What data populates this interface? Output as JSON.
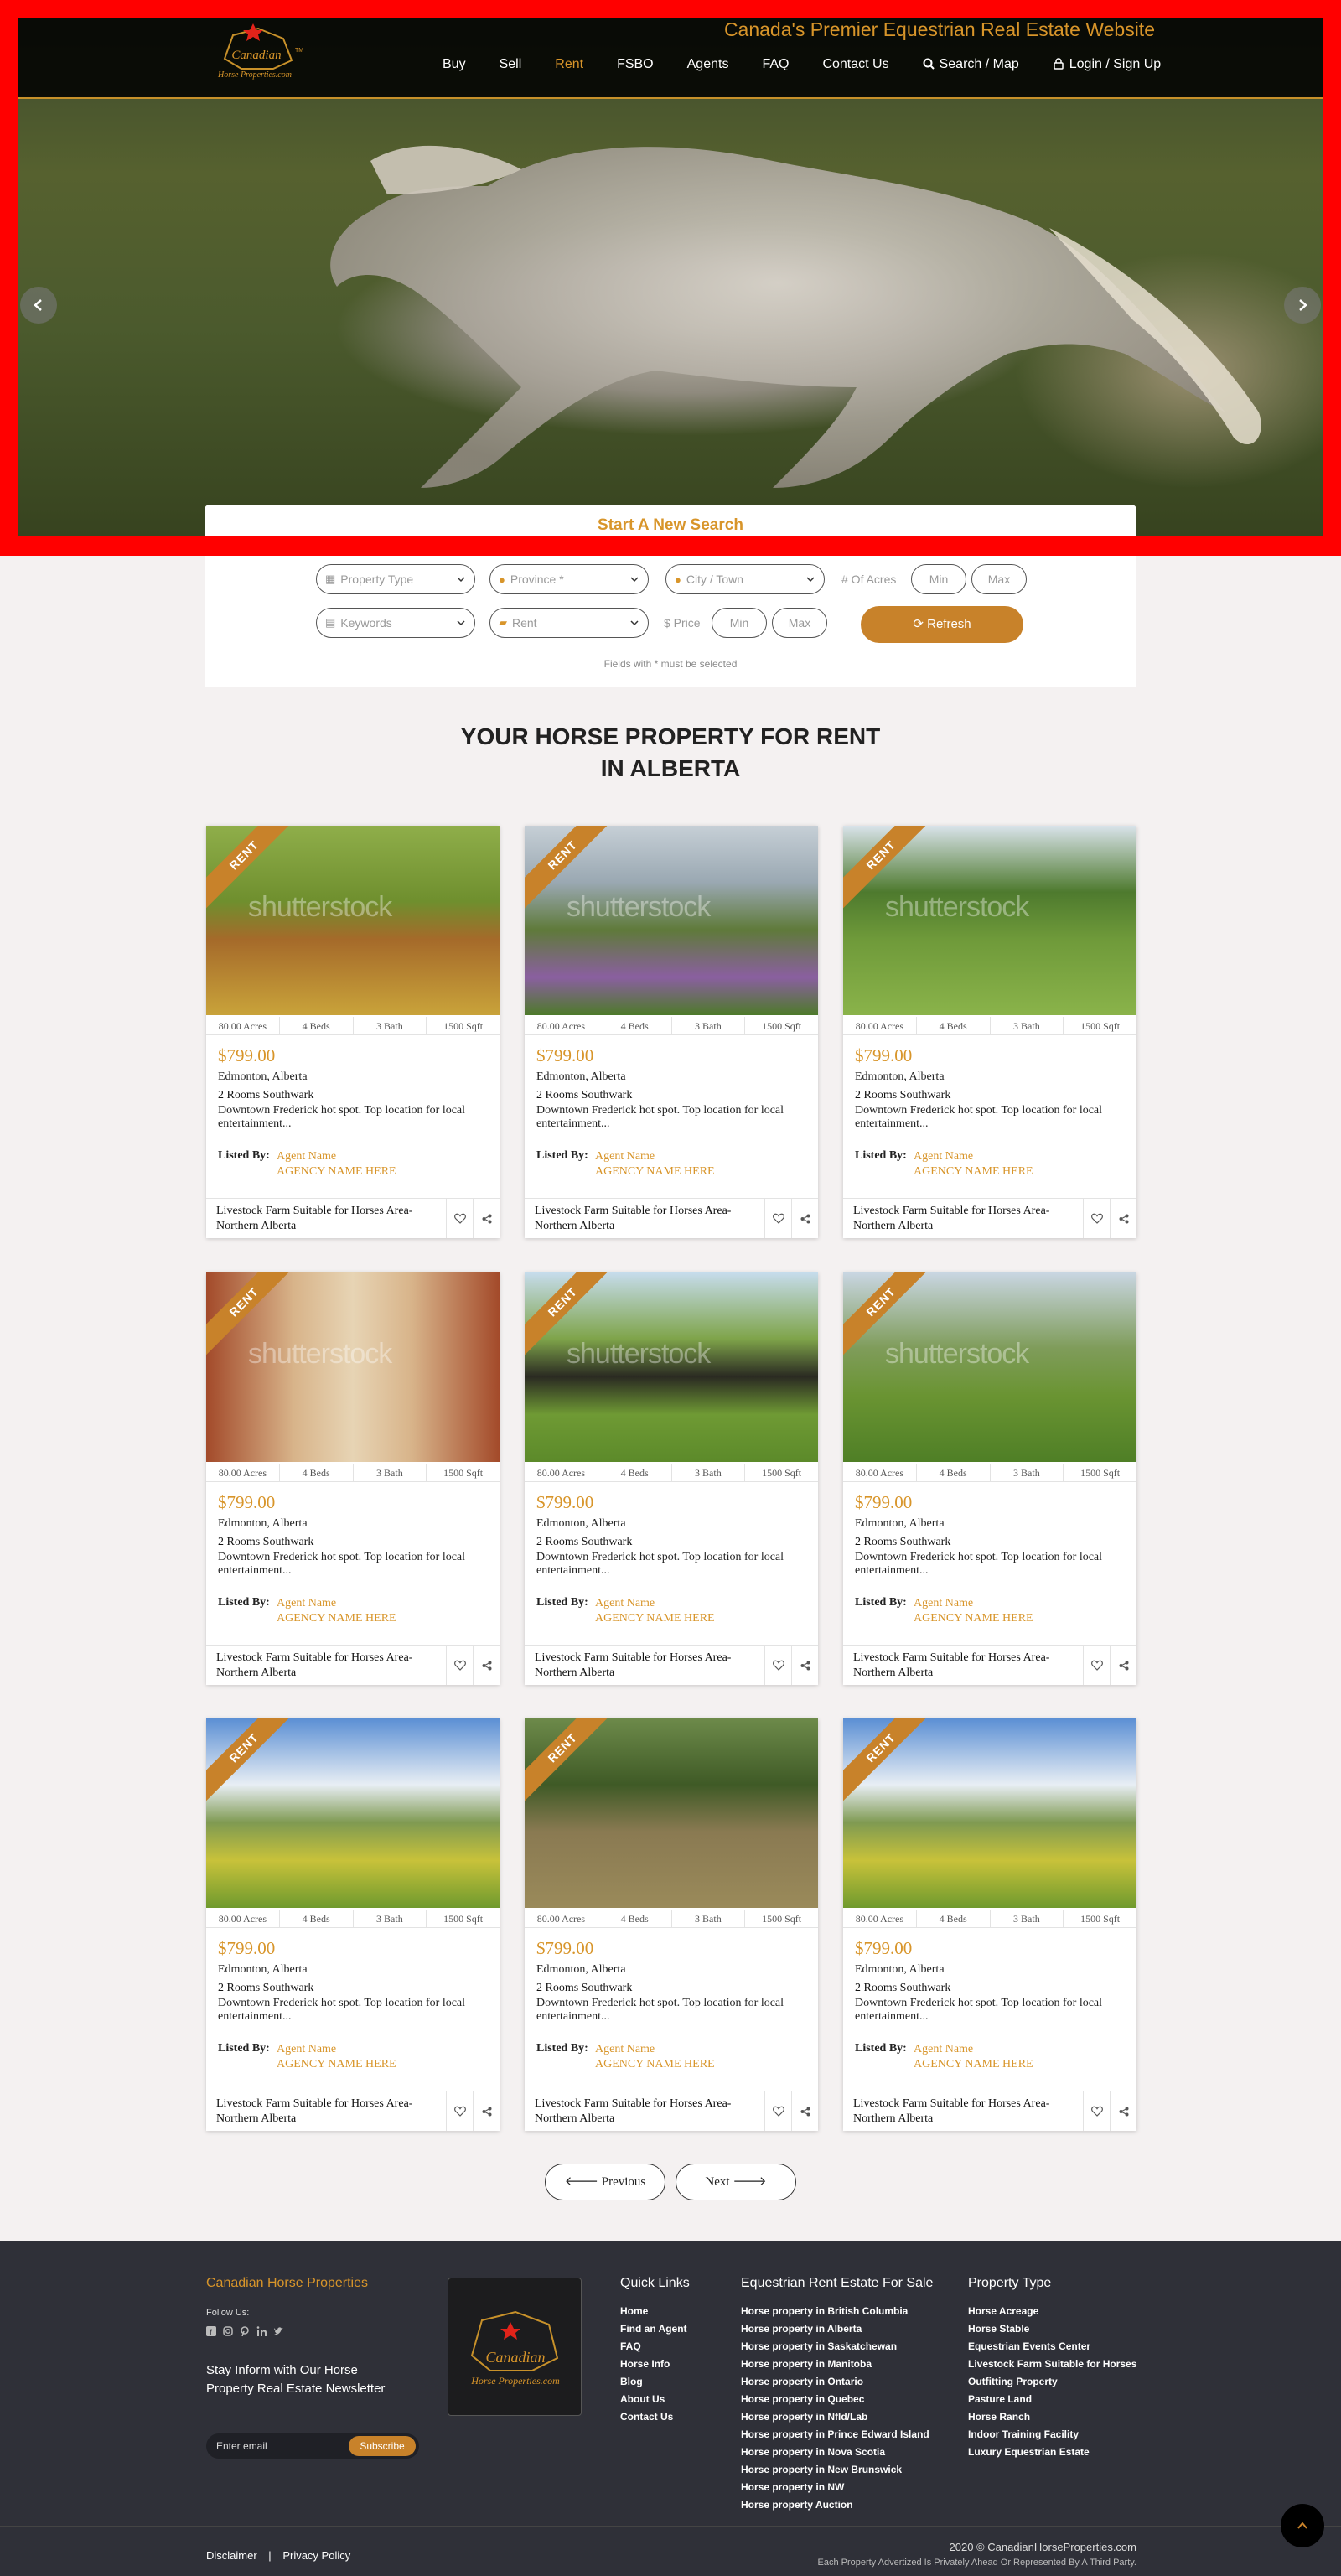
{
  "header": {
    "tagline": "Canada's Premier Equestrian Real Estate Website",
    "logo_brand": "Canadian",
    "logo_tm": "TM",
    "logo_sub": "Horse Properties.com",
    "nav": [
      {
        "label": "Buy",
        "active": false
      },
      {
        "label": "Sell",
        "active": false
      },
      {
        "label": "Rent",
        "active": true
      },
      {
        "label": "FSBO",
        "active": false
      },
      {
        "label": "Agents",
        "active": false
      },
      {
        "label": "FAQ",
        "active": false
      },
      {
        "label": "Contact Us",
        "active": false
      }
    ],
    "search_map": "Search / Map",
    "login": "Login / Sign Up"
  },
  "hero": {
    "prev_icon": "chevron-left-icon",
    "next_icon": "chevron-right-icon",
    "start_search": "Start A New Search"
  },
  "search": {
    "property_type": "Property Type",
    "province": "Province *",
    "city": "City / Town",
    "acres_label": "# Of Acres",
    "acres_min": "Min",
    "acres_max": "Max",
    "keywords": "Keywords",
    "listing_type": "Rent",
    "price_label": "$ Price",
    "price_min": "Min",
    "price_max": "Max",
    "refresh": "Refresh",
    "note": "Fields with * must be selected"
  },
  "heading": {
    "line1": "YOUR HORSE PROPERTY FOR RENT",
    "line2": "IN ALBERTA"
  },
  "listings": [
    {
      "badge": "RENT",
      "watermark": "shutterstock",
      "acres": "80.00 Acres",
      "beds": "4 Beds",
      "bath": "3 Bath",
      "sqft": "1500 Sqft",
      "price": "$799.00",
      "city": "Edmonton, Alberta",
      "rooms": "2 Rooms Southwark",
      "desc": "Downtown Frederick hot spot. Top location for local entertainment...",
      "listed_by": "Listed By:",
      "agent": "Agent Name",
      "agency": "AGENCY NAME HERE",
      "title": "Livestock Farm Suitable for Horses Area-Northern Alberta"
    },
    {
      "badge": "RENT",
      "watermark": "shutterstock",
      "acres": "80.00 Acres",
      "beds": "4 Beds",
      "bath": "3 Bath",
      "sqft": "1500 Sqft",
      "price": "$799.00",
      "city": "Edmonton, Alberta",
      "rooms": "2 Rooms Southwark",
      "desc": "Downtown Frederick hot spot. Top location for local entertainment...",
      "listed_by": "Listed By:",
      "agent": "Agent Name",
      "agency": "AGENCY NAME HERE",
      "title": "Livestock Farm Suitable for Horses Area-Northern Alberta"
    },
    {
      "badge": "RENT",
      "watermark": "shutterstock",
      "acres": "80.00 Acres",
      "beds": "4 Beds",
      "bath": "3 Bath",
      "sqft": "1500 Sqft",
      "price": "$799.00",
      "city": "Edmonton, Alberta",
      "rooms": "2 Rooms Southwark",
      "desc": "Downtown Frederick hot spot. Top location for local entertainment...",
      "listed_by": "Listed By:",
      "agent": "Agent Name",
      "agency": "AGENCY NAME HERE",
      "title": "Livestock Farm Suitable for Horses Area-Northern Alberta"
    },
    {
      "badge": "RENT",
      "watermark": "shutterstock",
      "acres": "80.00 Acres",
      "beds": "4 Beds",
      "bath": "3 Bath",
      "sqft": "1500 Sqft",
      "price": "$799.00",
      "city": "Edmonton, Alberta",
      "rooms": "2 Rooms Southwark",
      "desc": "Downtown Frederick hot spot. Top location for local entertainment...",
      "listed_by": "Listed By:",
      "agent": "Agent Name",
      "agency": "AGENCY NAME HERE",
      "title": "Livestock Farm Suitable for Horses Area-Northern Alberta"
    },
    {
      "badge": "RENT",
      "watermark": "shutterstock",
      "acres": "80.00 Acres",
      "beds": "4 Beds",
      "bath": "3 Bath",
      "sqft": "1500 Sqft",
      "price": "$799.00",
      "city": "Edmonton, Alberta",
      "rooms": "2 Rooms Southwark",
      "desc": "Downtown Frederick hot spot. Top location for local entertainment...",
      "listed_by": "Listed By:",
      "agent": "Agent Name",
      "agency": "AGENCY NAME HERE",
      "title": "Livestock Farm Suitable for Horses Area-Northern Alberta"
    },
    {
      "badge": "RENT",
      "watermark": "shutterstock",
      "acres": "80.00 Acres",
      "beds": "4 Beds",
      "bath": "3 Bath",
      "sqft": "1500 Sqft",
      "price": "$799.00",
      "city": "Edmonton, Alberta",
      "rooms": "2 Rooms Southwark",
      "desc": "Downtown Frederick hot spot. Top location for local entertainment...",
      "listed_by": "Listed By:",
      "agent": "Agent Name",
      "agency": "AGENCY NAME HERE",
      "title": "Livestock Farm Suitable for Horses Area-Northern Alberta"
    },
    {
      "badge": "RENT",
      "watermark": "",
      "acres": "80.00 Acres",
      "beds": "4 Beds",
      "bath": "3 Bath",
      "sqft": "1500 Sqft",
      "price": "$799.00",
      "city": "Edmonton, Alberta",
      "rooms": "2 Rooms Southwark",
      "desc": "Downtown Frederick hot spot. Top location for local entertainment...",
      "listed_by": "Listed By:",
      "agent": "Agent Name",
      "agency": "AGENCY NAME HERE",
      "title": "Livestock Farm Suitable for Horses Area-Northern Alberta"
    },
    {
      "badge": "RENT",
      "watermark": "",
      "acres": "80.00 Acres",
      "beds": "4 Beds",
      "bath": "3 Bath",
      "sqft": "1500 Sqft",
      "price": "$799.00",
      "city": "Edmonton, Alberta",
      "rooms": "2 Rooms Southwark",
      "desc": "Downtown Frederick hot spot. Top location for local entertainment...",
      "listed_by": "Listed By:",
      "agent": "Agent Name",
      "agency": "AGENCY NAME HERE",
      "title": "Livestock Farm Suitable for Horses Area-Northern Alberta"
    },
    {
      "badge": "RENT",
      "watermark": "",
      "acres": "80.00 Acres",
      "beds": "4 Beds",
      "bath": "3 Bath",
      "sqft": "1500 Sqft",
      "price": "$799.00",
      "city": "Edmonton, Alberta",
      "rooms": "2 Rooms Southwark",
      "desc": "Downtown Frederick hot spot. Top location for local entertainment...",
      "listed_by": "Listed By:",
      "agent": "Agent Name",
      "agency": "AGENCY NAME HERE",
      "title": "Livestock Farm Suitable for Horses Area-Northern Alberta"
    }
  ],
  "pagination": {
    "previous": "Previous",
    "next": "Next"
  },
  "footer": {
    "brand": "Canadian Horse Properties",
    "follow": "Follow Us:",
    "newsletter": "Stay Inform with Our Horse Property Real Estate Newsletter",
    "email_placeholder": "Enter email",
    "subscribe": "Subscribe",
    "quick_links_title": "Quick Links",
    "quick_links": [
      "Home",
      "Find an Agent",
      "FAQ",
      "Horse Info",
      "Blog",
      "About Us",
      "Contact Us"
    ],
    "rent_title": "Equestrian Rent Estate For Sale",
    "rent_links": [
      "Horse property in British Columbia",
      "Horse property in Alberta",
      "Horse property in Saskatchewan",
      "Horse property in Manitoba",
      "Horse property in Ontario",
      "Horse property in Quebec",
      "Horse property in Nfld/Lab",
      "Horse property in Prince Edward Island",
      "Horse property in Nova Scotia",
      "Horse property in New Brunswick",
      "Horse property in NW",
      "Horse property Auction"
    ],
    "type_title": "Property Type",
    "type_links": [
      "Horse Acreage",
      "Horse Stable",
      "Equestrian Events Center",
      "Livestock Farm Suitable for Horses",
      "Outfitting Property",
      "Pasture Land",
      "Horse Ranch",
      "Indoor Training Facility",
      "Luxury Equestrian Estate"
    ],
    "disclaimer": "Disclaimer",
    "separator": "|",
    "privacy": "Privacy Policy",
    "copyright": "2020 © CanadianHorseProperties.com",
    "advertised_note": "Each Property Advertized Is Privately Ahead Or Represented By A Third Party."
  }
}
